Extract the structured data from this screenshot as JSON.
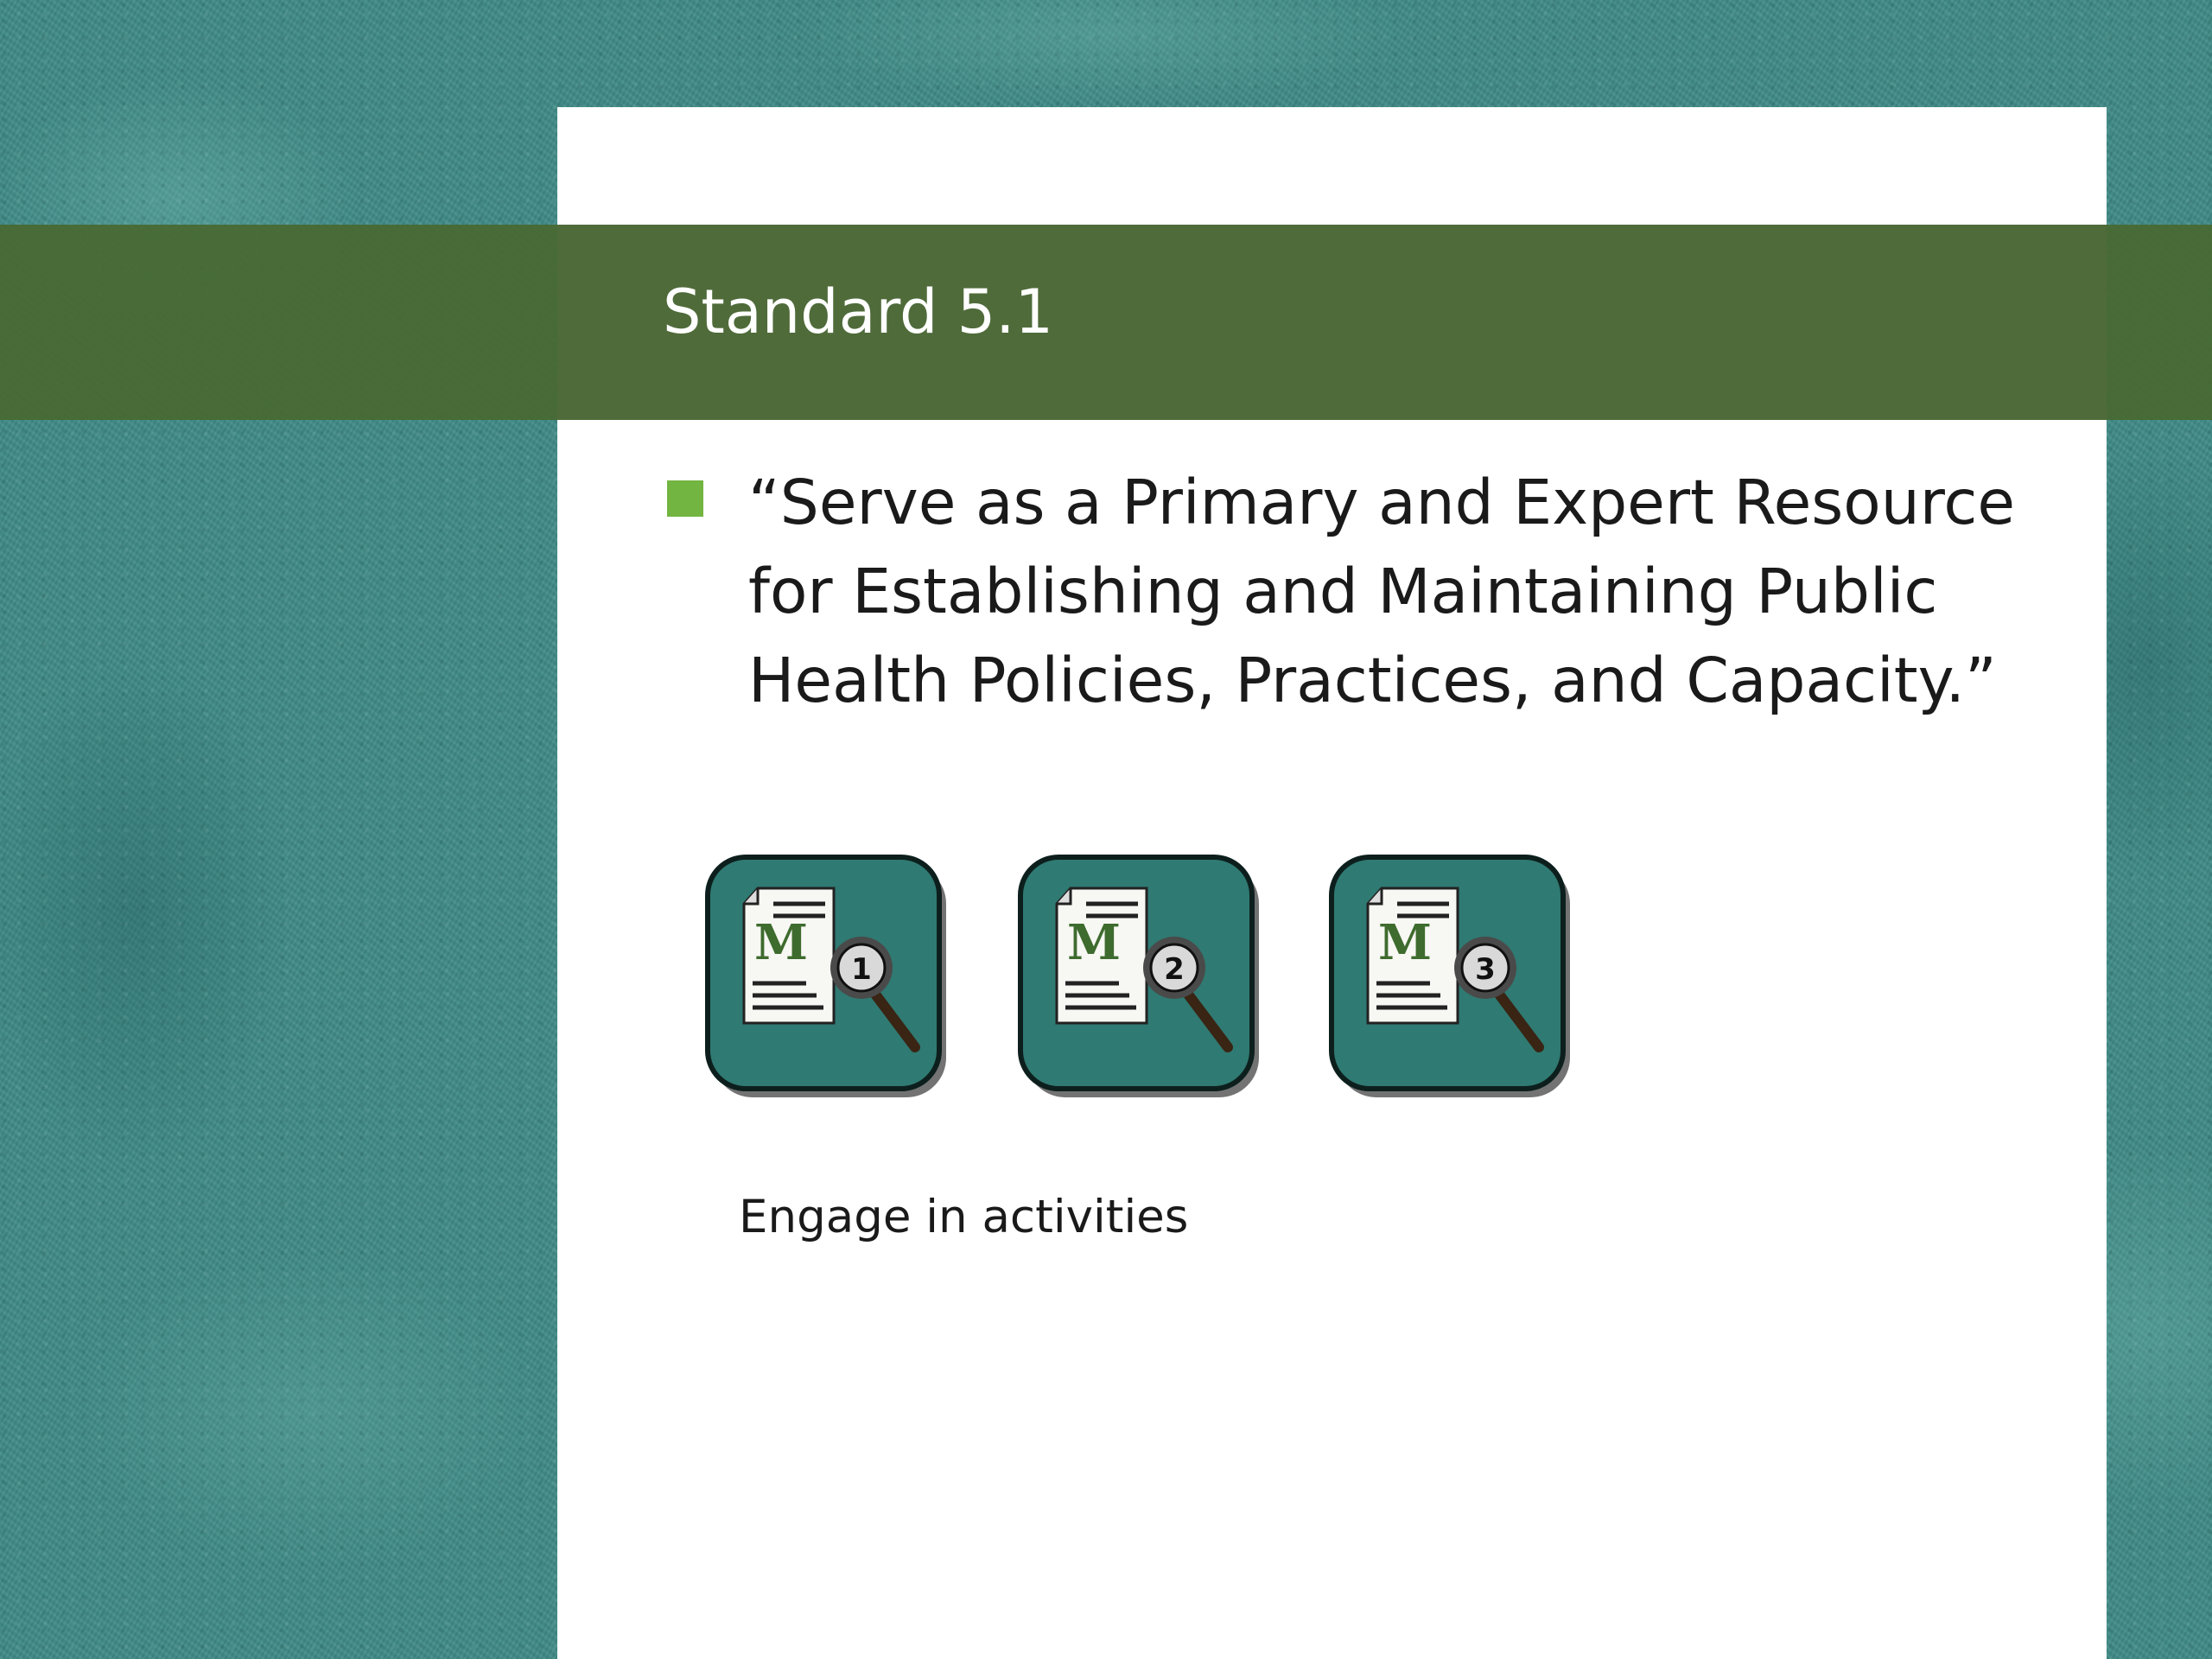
{
  "slide": {
    "title": "Standard 5.1",
    "bullet_text": "“Serve as a Primary and Expert Resource\nfor Establishing and Maintaining Public\nHealth  Policies, Practices, and Capacity.”",
    "engage_label": "Engage in activities"
  },
  "icons": [
    {
      "name": "module-1-icon",
      "letter": "M",
      "number": "1"
    },
    {
      "name": "module-2-icon",
      "letter": "M",
      "number": "2"
    },
    {
      "name": "module-3-icon",
      "letter": "M",
      "number": "3"
    }
  ],
  "colors": {
    "background": "#3f8a86",
    "title_band": "#4f6b3a",
    "bullet": "#72b541",
    "icon_tile": "#2f7a72",
    "icon_letter": "#3e6b2e"
  }
}
